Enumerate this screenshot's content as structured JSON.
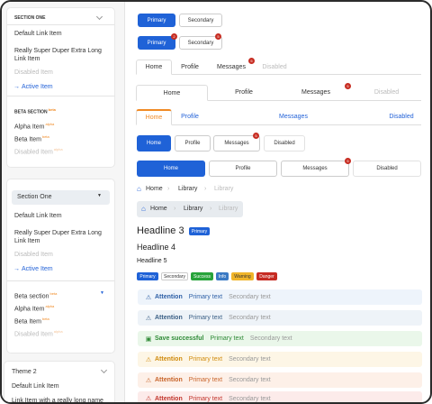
{
  "sidebar": {
    "nav1": {
      "header": "SECTION ONE",
      "default_item": "Default Link Item",
      "long_item": "Really Super Duper Extra Long Link Item",
      "disabled_item": "Disabled Item",
      "active_item": "Active Item",
      "beta_header": "BETA SECTION",
      "beta_badge": "beta",
      "alpha_item": "Alpha Item",
      "alpha_badge": "alpha",
      "beta_item": "Beta Item",
      "beta_item_badge": "beta",
      "beta_disabled": "Disabled Item",
      "beta_disabled_badge": "alpha"
    },
    "nav2": {
      "header": "Section One",
      "default_item": "Default Link Item",
      "long_item": "Really Super Duper Extra Long Link Item",
      "disabled_item": "Disabled Item",
      "active_item": "Active Item",
      "beta_header": "Beta section",
      "beta_badge": "beta",
      "alpha_item": "Alpha Item",
      "alpha_badge": "alpha",
      "beta_item": "Beta Item",
      "beta_item_badge": "beta",
      "beta_disabled": "Disabled Item",
      "beta_disabled_badge": "alpha"
    },
    "nav3": {
      "header": "Theme 2",
      "default_item": "Default Link Item",
      "long_item": "Link Item with a really long name"
    }
  },
  "buttons": {
    "primary": "Primary",
    "secondary": "Secondary",
    "primary_badge": "2",
    "secondary_badge": "5"
  },
  "tabs": {
    "home": "Home",
    "profile": "Profile",
    "messages": "Messages",
    "disabled": "Disabled",
    "messages_badge": "5"
  },
  "breadcrumbs": {
    "home": "Home",
    "library1": "Library",
    "library2": "Library",
    "sep": "›"
  },
  "headings": {
    "h3": "Headline 3",
    "h3_tag": "Primary",
    "h4": "Headline 4",
    "h5": "Headline 5"
  },
  "tags": {
    "primary": "Primary",
    "secondary": "Secondary",
    "success": "Success",
    "info": "Info",
    "warning": "Warning",
    "danger": "Danger"
  },
  "alerts": [
    {
      "title": "Attention",
      "primary": "Primary text",
      "secondary": "Secondary text",
      "icon": "warning-triangle-icon"
    },
    {
      "title": "Attention",
      "primary": "Primary text",
      "secondary": "Secondary text",
      "icon": "warning-triangle-icon"
    },
    {
      "title": "Save successful",
      "primary": "Primary text",
      "secondary": "Secondary text",
      "icon": "save-icon"
    },
    {
      "title": "Attention",
      "primary": "Primary text",
      "secondary": "Secondary text",
      "icon": "warning-triangle-icon"
    },
    {
      "title": "Attention",
      "primary": "Primary text",
      "secondary": "Secondary text",
      "icon": "warning-triangle-icon"
    },
    {
      "title": "Attention",
      "primary": "Primary text",
      "secondary": "Secondary text",
      "icon": "warning-triangle-icon"
    }
  ],
  "colors": {
    "primary": "#1f62d7",
    "badge_red": "#c72d22",
    "accent_orange": "#f08a24",
    "success": "#27a33a",
    "info": "#3b7ac4",
    "warning": "#f0b429",
    "danger": "#c62b22"
  }
}
